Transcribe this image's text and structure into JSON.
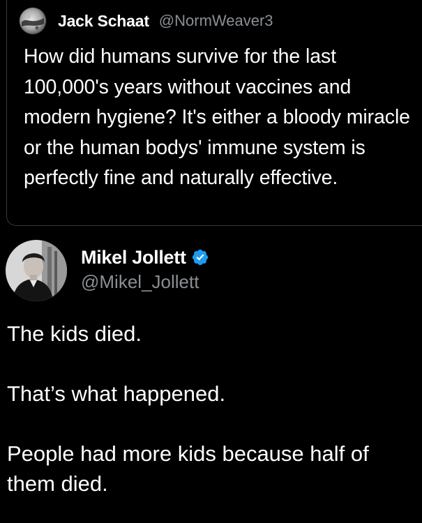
{
  "quoted_tweet": {
    "author_name": "Jack Schaat",
    "author_handle": "@NormWeaver3",
    "avatar_icon": "moon-avatar-icon",
    "text": "How did humans survive for the last 100,000's years without vaccines and modern hygiene? It's either a bloody miracle or the human bodys' immune system is perfectly fine and naturally effective."
  },
  "tweet": {
    "author_name": "Mikel Jollett",
    "author_handle": "@Mikel_Jollett",
    "verified_icon": "verified-badge-icon",
    "verified_color": "#1d9bf0",
    "paragraphs": [
      "The kids died.",
      "That’s what happened.",
      "People had more kids because half of them died."
    ]
  }
}
